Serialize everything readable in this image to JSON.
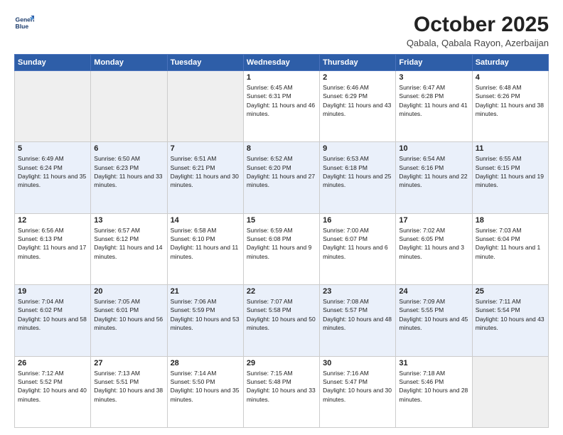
{
  "header": {
    "logo_line1": "General",
    "logo_line2": "Blue",
    "month": "October 2025",
    "location": "Qabala, Qabala Rayon, Azerbaijan"
  },
  "weekdays": [
    "Sunday",
    "Monday",
    "Tuesday",
    "Wednesday",
    "Thursday",
    "Friday",
    "Saturday"
  ],
  "weeks": [
    [
      {
        "day": "",
        "empty": true
      },
      {
        "day": "",
        "empty": true
      },
      {
        "day": "",
        "empty": true
      },
      {
        "day": "1",
        "sunrise": "6:45 AM",
        "sunset": "6:31 PM",
        "daylight": "11 hours and 46 minutes."
      },
      {
        "day": "2",
        "sunrise": "6:46 AM",
        "sunset": "6:29 PM",
        "daylight": "11 hours and 43 minutes."
      },
      {
        "day": "3",
        "sunrise": "6:47 AM",
        "sunset": "6:28 PM",
        "daylight": "11 hours and 41 minutes."
      },
      {
        "day": "4",
        "sunrise": "6:48 AM",
        "sunset": "6:26 PM",
        "daylight": "11 hours and 38 minutes."
      }
    ],
    [
      {
        "day": "5",
        "sunrise": "6:49 AM",
        "sunset": "6:24 PM",
        "daylight": "11 hours and 35 minutes."
      },
      {
        "day": "6",
        "sunrise": "6:50 AM",
        "sunset": "6:23 PM",
        "daylight": "11 hours and 33 minutes."
      },
      {
        "day": "7",
        "sunrise": "6:51 AM",
        "sunset": "6:21 PM",
        "daylight": "11 hours and 30 minutes."
      },
      {
        "day": "8",
        "sunrise": "6:52 AM",
        "sunset": "6:20 PM",
        "daylight": "11 hours and 27 minutes."
      },
      {
        "day": "9",
        "sunrise": "6:53 AM",
        "sunset": "6:18 PM",
        "daylight": "11 hours and 25 minutes."
      },
      {
        "day": "10",
        "sunrise": "6:54 AM",
        "sunset": "6:16 PM",
        "daylight": "11 hours and 22 minutes."
      },
      {
        "day": "11",
        "sunrise": "6:55 AM",
        "sunset": "6:15 PM",
        "daylight": "11 hours and 19 minutes."
      }
    ],
    [
      {
        "day": "12",
        "sunrise": "6:56 AM",
        "sunset": "6:13 PM",
        "daylight": "11 hours and 17 minutes."
      },
      {
        "day": "13",
        "sunrise": "6:57 AM",
        "sunset": "6:12 PM",
        "daylight": "11 hours and 14 minutes."
      },
      {
        "day": "14",
        "sunrise": "6:58 AM",
        "sunset": "6:10 PM",
        "daylight": "11 hours and 11 minutes."
      },
      {
        "day": "15",
        "sunrise": "6:59 AM",
        "sunset": "6:08 PM",
        "daylight": "11 hours and 9 minutes."
      },
      {
        "day": "16",
        "sunrise": "7:00 AM",
        "sunset": "6:07 PM",
        "daylight": "11 hours and 6 minutes."
      },
      {
        "day": "17",
        "sunrise": "7:02 AM",
        "sunset": "6:05 PM",
        "daylight": "11 hours and 3 minutes."
      },
      {
        "day": "18",
        "sunrise": "7:03 AM",
        "sunset": "6:04 PM",
        "daylight": "11 hours and 1 minute."
      }
    ],
    [
      {
        "day": "19",
        "sunrise": "7:04 AM",
        "sunset": "6:02 PM",
        "daylight": "10 hours and 58 minutes."
      },
      {
        "day": "20",
        "sunrise": "7:05 AM",
        "sunset": "6:01 PM",
        "daylight": "10 hours and 56 minutes."
      },
      {
        "day": "21",
        "sunrise": "7:06 AM",
        "sunset": "5:59 PM",
        "daylight": "10 hours and 53 minutes."
      },
      {
        "day": "22",
        "sunrise": "7:07 AM",
        "sunset": "5:58 PM",
        "daylight": "10 hours and 50 minutes."
      },
      {
        "day": "23",
        "sunrise": "7:08 AM",
        "sunset": "5:57 PM",
        "daylight": "10 hours and 48 minutes."
      },
      {
        "day": "24",
        "sunrise": "7:09 AM",
        "sunset": "5:55 PM",
        "daylight": "10 hours and 45 minutes."
      },
      {
        "day": "25",
        "sunrise": "7:11 AM",
        "sunset": "5:54 PM",
        "daylight": "10 hours and 43 minutes."
      }
    ],
    [
      {
        "day": "26",
        "sunrise": "7:12 AM",
        "sunset": "5:52 PM",
        "daylight": "10 hours and 40 minutes."
      },
      {
        "day": "27",
        "sunrise": "7:13 AM",
        "sunset": "5:51 PM",
        "daylight": "10 hours and 38 minutes."
      },
      {
        "day": "28",
        "sunrise": "7:14 AM",
        "sunset": "5:50 PM",
        "daylight": "10 hours and 35 minutes."
      },
      {
        "day": "29",
        "sunrise": "7:15 AM",
        "sunset": "5:48 PM",
        "daylight": "10 hours and 33 minutes."
      },
      {
        "day": "30",
        "sunrise": "7:16 AM",
        "sunset": "5:47 PM",
        "daylight": "10 hours and 30 minutes."
      },
      {
        "day": "31",
        "sunrise": "7:18 AM",
        "sunset": "5:46 PM",
        "daylight": "10 hours and 28 minutes."
      },
      {
        "day": "",
        "empty": true
      }
    ]
  ],
  "labels": {
    "sunrise": "Sunrise:",
    "sunset": "Sunset:",
    "daylight": "Daylight:"
  }
}
